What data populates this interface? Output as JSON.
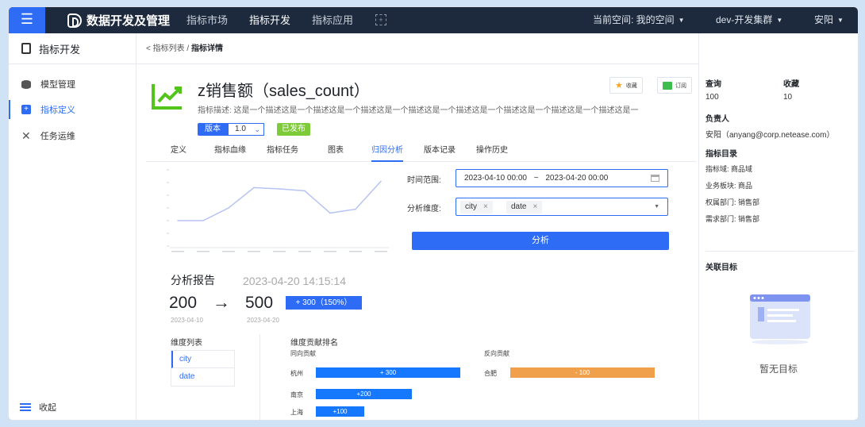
{
  "topbar": {
    "menu_icon": "hamburger-icon",
    "brand": "数据开发及管理",
    "nav": [
      "指标市场",
      "指标开发",
      "指标应用"
    ],
    "nav_active": "指标开发",
    "space": "当前空间: 我的空间",
    "cluster": "dev-开发集群",
    "user": "安阳",
    "accent": "#2e6cf6",
    "bg": "#1d2a3d"
  },
  "sidebar": {
    "title": "指标开发",
    "items": [
      {
        "label": "模型管理",
        "icon": "database-icon"
      },
      {
        "label": "指标定义",
        "icon": "definition-icon"
      },
      {
        "label": "任务运维",
        "icon": "tools-icon"
      }
    ],
    "active_item": "指标定义",
    "collapse": "收起"
  },
  "breadcrumb": {
    "back": "< 指标列表 / ",
    "current": "指标详情"
  },
  "metric": {
    "title": "z销售额（sales_count）",
    "description": "指标描述: 这是一个描述这是一个描述这是一个描述这是一个描述这是一个描述这是一个描述这是一个描述这是一个描述这是一",
    "version_label": "版本",
    "version": "1.0",
    "status": "已发布",
    "collect_btn": "收藏",
    "subscribe_btn": "订阅"
  },
  "tabs": [
    "定义",
    "指标血缘",
    "指标任务",
    "图表",
    "归因分析",
    "版本记录",
    "操作历史"
  ],
  "active_tab": "归因分析",
  "analysis": {
    "time_label": "时间范围:",
    "time_start": "2023-04-10 00:00",
    "time_sep": "~",
    "time_end": "2023-04-20 00:00",
    "dim_label": "分析维度:",
    "dims": [
      "city",
      "date"
    ],
    "button": "分析"
  },
  "chart_data": {
    "type": "line",
    "categories": [
      "2023-04-10",
      "2023-04-11",
      "2023-04-12",
      "2023-04-13",
      "2023-04-14",
      "2023-04-15",
      "2023-04-16",
      "2023-04-17",
      "2023-04-18"
    ],
    "values": [
      200,
      200,
      300,
      460,
      450,
      435,
      260,
      290,
      510
    ],
    "ylim": [
      0,
      600
    ],
    "grid": false,
    "color": "#b7c3f2"
  },
  "report": {
    "title": "分析报告",
    "time": "2023-04-20 14:15:14",
    "from_value": "200",
    "to_value": "500",
    "arrow": "→",
    "change": "+ 300（150%）",
    "from_date": "2023-04-10",
    "to_date": "2023-04-20"
  },
  "dimension_list": {
    "title": "维度列表",
    "items": [
      "city",
      "date"
    ]
  },
  "ranking": {
    "title": "维度贡献排名",
    "positive_title": "同向贡献",
    "negative_title": "反向贡献",
    "positive": [
      {
        "city": "杭州",
        "label": "+ 300",
        "value": 300
      },
      {
        "city": "南京",
        "label": "+200",
        "value": 200
      },
      {
        "city": "上海",
        "label": "+100",
        "value": 100
      }
    ],
    "negative": [
      {
        "city": "合肥",
        "label": "- 100",
        "value": -100
      }
    ],
    "positive_color": "#1677ff",
    "negative_color": "#f0a04b"
  },
  "right_panel": {
    "query_label": "查询",
    "query_value": "100",
    "collect_label": "收藏",
    "collect_value": "10",
    "owner_label": "负责人",
    "owner_value": "安阳（anyang@corp.netease.com）",
    "catalog_label": "指标目录",
    "catalog": [
      "指标域: 商品域",
      "业务板块: 商品",
      "权属部门: 销售部",
      "需求部门: 销售部"
    ],
    "related_label": "关联目标",
    "empty_text": "暂无目标"
  }
}
